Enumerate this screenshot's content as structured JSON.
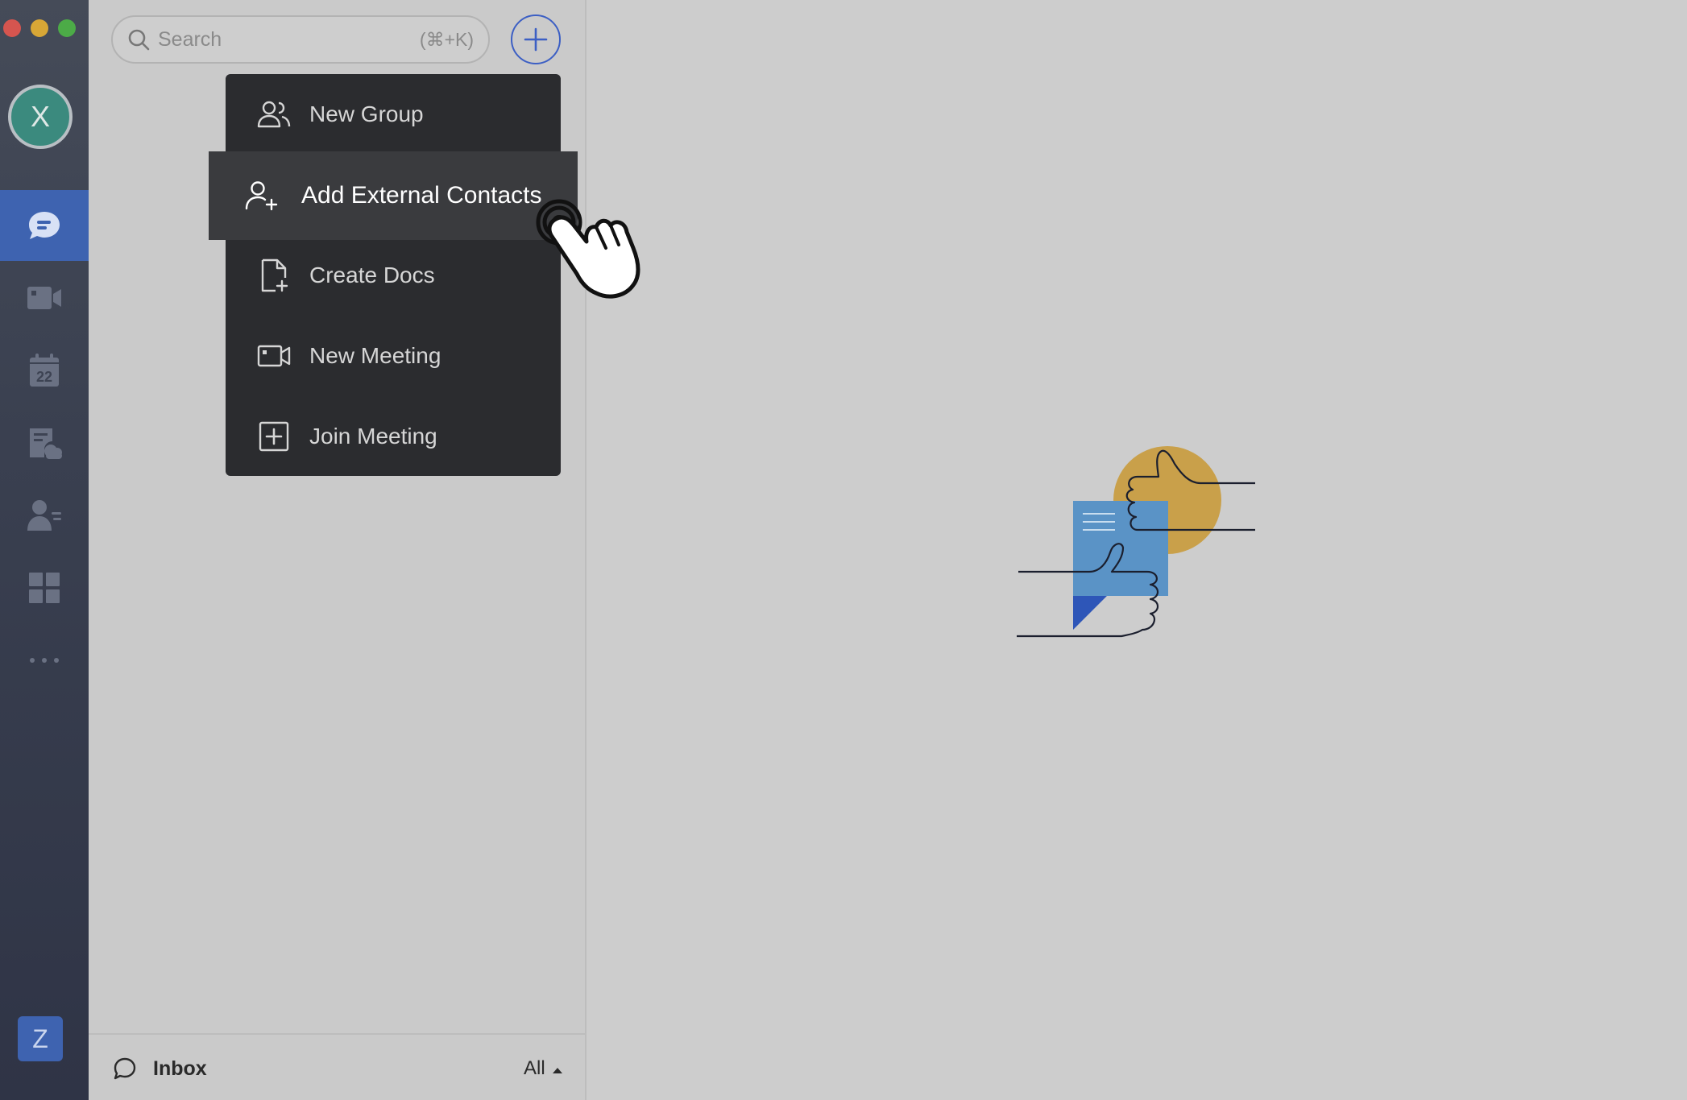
{
  "window": {
    "traffic_lights": [
      "#d6554f",
      "#d8a736",
      "#4cab47"
    ]
  },
  "rail": {
    "avatar_initial": "X",
    "items": [
      {
        "icon": "chat-icon",
        "active": true
      },
      {
        "icon": "video-icon",
        "active": false
      },
      {
        "icon": "calendar-icon",
        "calendar_day": "22",
        "active": false
      },
      {
        "icon": "docs-cloud-icon",
        "active": false
      },
      {
        "icon": "contacts-icon",
        "active": false
      },
      {
        "icon": "apps-grid-icon",
        "active": false
      },
      {
        "icon": "more-icon",
        "active": false
      }
    ],
    "brand_logo": "Z",
    "accent_color": "#3e63b0"
  },
  "search": {
    "placeholder": "Search",
    "shortcut": "(⌘+K)"
  },
  "menu": {
    "items": [
      {
        "label": "New Group",
        "icon": "group-icon"
      },
      {
        "label": "Add External Contacts",
        "icon": "add-contact-icon",
        "highlighted": true
      },
      {
        "label": "Create Docs",
        "icon": "create-doc-icon"
      },
      {
        "label": "New Meeting",
        "icon": "video-camera-icon"
      },
      {
        "label": "Join Meeting",
        "icon": "plus-square-icon"
      }
    ]
  },
  "footer": {
    "inbox_label": "Inbox",
    "filter_label": "All"
  }
}
